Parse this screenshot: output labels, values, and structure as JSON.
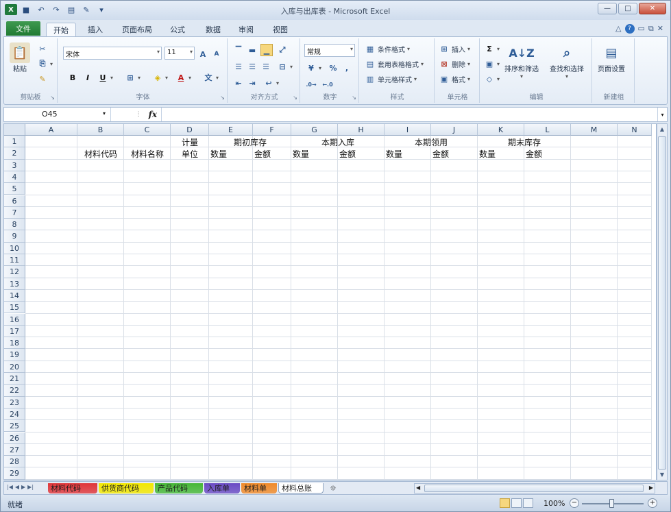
{
  "window": {
    "title": "入库与出库表 - Microsoft Excel",
    "controls": {
      "minimize": "—",
      "maximize": "□",
      "close": "✕"
    }
  },
  "qat": {
    "app_icon": "X",
    "save": "■",
    "undo": "↶",
    "redo": "↷",
    "print_preview": "▤",
    "format_painter": "✎",
    "customize": "▾"
  },
  "ribbon_tabs": {
    "file": "文件",
    "tabs": [
      "开始",
      "插入",
      "页面布局",
      "公式",
      "数据",
      "审阅",
      "视图"
    ],
    "active_index": 0
  },
  "ribbon_right": {
    "minimize_ribbon": "△",
    "help": "?",
    "min": "▭",
    "restore": "⧉",
    "close": "✕"
  },
  "ribbon": {
    "clipboard": {
      "label": "剪贴板",
      "paste": "粘贴"
    },
    "font": {
      "label": "字体",
      "font_name": "宋体",
      "font_size": "11",
      "grow": "A",
      "shrink": "A",
      "bold": "B",
      "italic": "I",
      "underline": "U",
      "border": "⊞",
      "fill": "◈",
      "font_color": "A",
      "phonetic": "文"
    },
    "alignment": {
      "label": "对齐方式"
    },
    "number": {
      "label": "数字",
      "format": "常规",
      "percent": "%",
      "comma": ","
    },
    "styles": {
      "label": "样式",
      "conditional": "条件格式",
      "table_format": "套用表格格式",
      "cell_styles": "单元格样式"
    },
    "cells": {
      "label": "单元格",
      "insert": "插入",
      "delete": "删除",
      "format": "格式"
    },
    "editing": {
      "label": "编辑",
      "sum": "Σ",
      "fill": "▣",
      "clear": "◇",
      "sort_filter": "排序和筛选",
      "find_select": "查找和选择"
    },
    "new_group": {
      "label": "新建组",
      "page_setup": "页面设置"
    }
  },
  "formula_bar": {
    "name_box": "O45",
    "fx": "fx",
    "formula": ""
  },
  "grid": {
    "columns": [
      "A",
      "B",
      "C",
      "D",
      "E",
      "F",
      "G",
      "H",
      "I",
      "J",
      "K",
      "L",
      "M",
      "N"
    ],
    "rows": [
      "1",
      "2",
      "3",
      "4",
      "5",
      "6",
      "7",
      "8",
      "9",
      "10",
      "11",
      "12",
      "13",
      "14",
      "15",
      "16",
      "17",
      "18",
      "19",
      "20",
      "21",
      "22",
      "23",
      "24",
      "25",
      "26",
      "27",
      "28",
      "29"
    ],
    "cells": {
      "D1": "计量",
      "D2": "单位",
      "E1": "期初库存",
      "G1": "本期入库",
      "I1": "本期领用",
      "K1": "期末库存",
      "B2": "材料代码",
      "C2": "材料名称",
      "E2": "数量",
      "F2": "金额",
      "G2": "数量",
      "H2": "金额",
      "I2": "数量",
      "J2": "金额",
      "K2": "数量",
      "L2": "金额"
    }
  },
  "sheet_tabs": {
    "nav": [
      "|◀",
      "◀",
      "▶",
      "▶|"
    ],
    "tabs": [
      {
        "label": "材料代码",
        "color": "#e0363a"
      },
      {
        "label": "供货商代码",
        "color": "#f3e800"
      },
      {
        "label": "产品代码",
        "color": "#46b837"
      },
      {
        "label": "入库单",
        "color": "#6a4bc4"
      },
      {
        "label": "材料单",
        "color": "#f08a2a"
      },
      {
        "label": "材料总账",
        "color": "#ffffff"
      }
    ],
    "new_sheet": "☼"
  },
  "statusbar": {
    "status": "就绪",
    "zoom": "100%",
    "zoom_minus": "−",
    "zoom_plus": "+"
  }
}
